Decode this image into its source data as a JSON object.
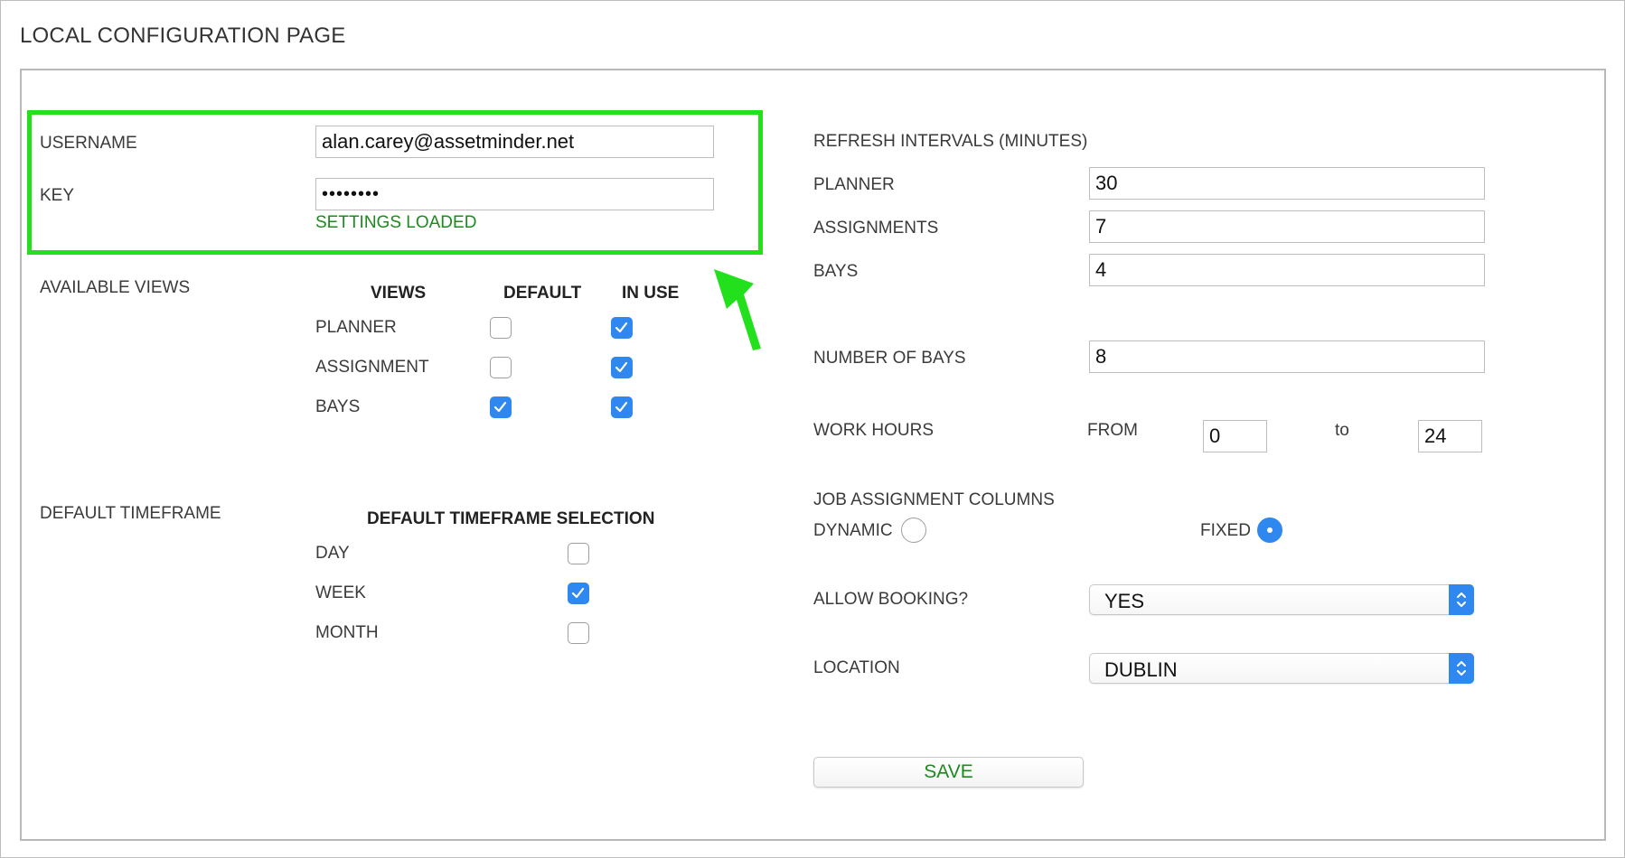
{
  "page": {
    "title": "LOCAL CONFIGURATION PAGE"
  },
  "credentials": {
    "username_label": "USERNAME",
    "username_value": "alan.carey@assetminder.net",
    "key_label": "KEY",
    "key_value": "••••••••",
    "status": "SETTINGS LOADED"
  },
  "available_views": {
    "label": "AVAILABLE VIEWS",
    "headers": {
      "views": "VIEWS",
      "default": "DEFAULT",
      "in_use": "IN USE"
    },
    "rows": [
      {
        "name": "PLANNER",
        "default": false,
        "in_use": true
      },
      {
        "name": "ASSIGNMENT",
        "default": false,
        "in_use": true
      },
      {
        "name": "BAYS",
        "default": true,
        "in_use": true
      }
    ]
  },
  "default_timeframe": {
    "label": "DEFAULT TIMEFRAME",
    "header": "DEFAULT TIMEFRAME SELECTION",
    "rows": [
      {
        "name": "DAY",
        "checked": false
      },
      {
        "name": "WEEK",
        "checked": true
      },
      {
        "name": "MONTH",
        "checked": false
      }
    ]
  },
  "refresh_intervals": {
    "label": "REFRESH INTERVALS (MINUTES)",
    "planner_label": "PLANNER",
    "planner_value": "30",
    "assignments_label": "ASSIGNMENTS",
    "assignments_value": "7",
    "bays_label": "BAYS",
    "bays_value": "4"
  },
  "number_of_bays": {
    "label": "NUMBER OF BAYS",
    "value": "8"
  },
  "work_hours": {
    "label": "WORK HOURS",
    "from_label": "FROM",
    "from_value": "0",
    "to_label": "to",
    "to_value": "24"
  },
  "job_assignment_columns": {
    "label": "JOB ASSIGNMENT COLUMNS",
    "dynamic_label": "DYNAMIC",
    "fixed_label": "FIXED",
    "selected": "FIXED"
  },
  "allow_booking": {
    "label": "ALLOW BOOKING?",
    "value": "YES"
  },
  "location": {
    "label": "LOCATION",
    "value": "DUBLIN"
  },
  "actions": {
    "save_label": "SAVE"
  },
  "colors": {
    "accent_blue": "#2f87f0",
    "highlight_green": "#22e01c",
    "status_green": "#1d8a1d"
  },
  "icons": {
    "checkmark": "check-icon",
    "select_arrows": "chevron-up-down-icon",
    "annotation_arrow": "arrow-icon"
  }
}
